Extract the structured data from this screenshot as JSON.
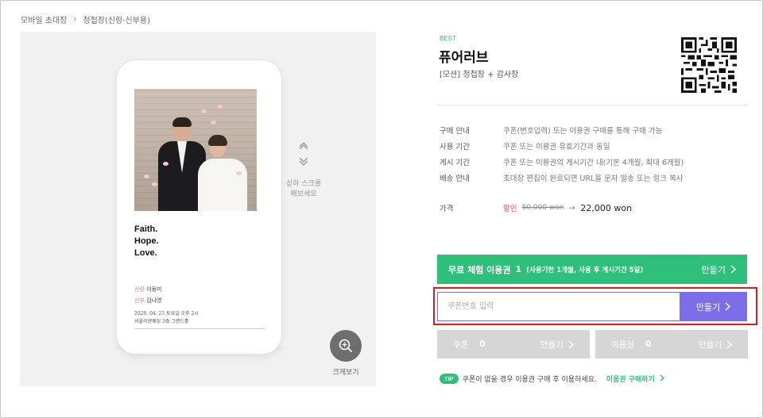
{
  "breadcrumb": {
    "items": [
      "모바일 초대장",
      "청첩장(신랑·신부용)"
    ],
    "separator": "›"
  },
  "preview": {
    "invitation": {
      "headline": [
        "Faith.",
        "Hope.",
        "Love."
      ],
      "groom_role": "신랑",
      "groom_name": "이동미",
      "bride_role": "신부",
      "bride_name": "김나영",
      "event_date": "2020. 04. 25 토요일 오후 2시",
      "event_place": "서울리엔웨딩 3층 그랜드홀"
    },
    "scroll_hint": "상하 스크롤\n해보세요",
    "zoom_label": "크게보기"
  },
  "product": {
    "badge": "BEST",
    "title": "퓨어러브",
    "subtitle": "[모션] 청첩장 + 감사장",
    "info": [
      {
        "key": "구매 안내",
        "value": "쿠폰(번호입력) 또는 이용권 구매를 통해 구매 가능"
      },
      {
        "key": "사용 기간",
        "value": "쿠폰 또는 이용권 유효기간과 동일"
      },
      {
        "key": "게시 기간",
        "value": "쿠폰 또는 이용권의 게시기간 내(기본 4개월, 최대 6개월)"
      },
      {
        "key": "배송 안내",
        "value": "초대장 편집이 완료되면 URL을 문자 발송 또는 링크 복사"
      }
    ],
    "price": {
      "label": "가격",
      "discount_label": "할인",
      "original": "50,000 won",
      "arrow": "→",
      "final": "22,000 won"
    }
  },
  "actions": {
    "trial": {
      "label": "무료 체험 이용권",
      "count": "1",
      "note": "(사용기한 1개월, 사용 후 게시기간 5일)",
      "make": "만들기"
    },
    "coupon_input": {
      "placeholder": "쿠폰번호 입력",
      "value": ""
    },
    "coupon_make": "만들기",
    "coupon": {
      "label": "쿠폰",
      "count": "0",
      "make": "만들기"
    },
    "pass": {
      "label": "이용권",
      "count": "0",
      "make": "만들기"
    },
    "tip": {
      "badge": "TIP",
      "text": "쿠폰이 없을 경우 이용권 구매 후 이용하세요.",
      "link": "이용권 구매하기"
    }
  },
  "colors": {
    "accent_green": "#2ec07b",
    "accent_purple": "#7b6ee8",
    "highlight_red": "#e41a1a",
    "discount_red": "#e2574c",
    "disabled_gray": "#d6d6d6"
  }
}
